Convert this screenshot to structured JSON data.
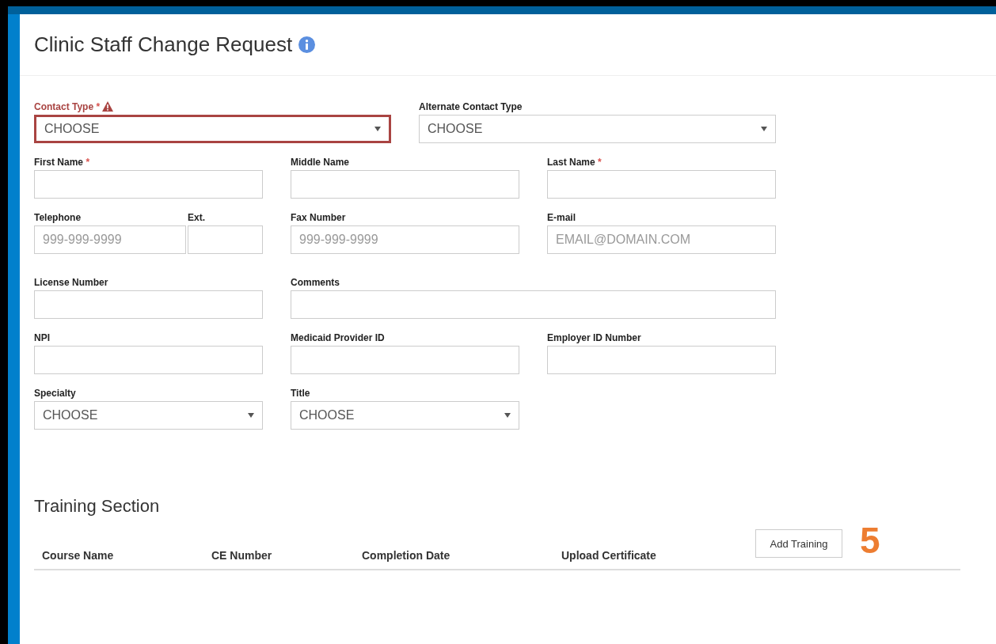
{
  "title": "Clinic Staff Change Request",
  "rows": [
    {
      "kind": "pair",
      "fields": [
        {
          "kind": "select",
          "label": "Contact Type",
          "required_mark": "*",
          "error": true,
          "value": "CHOOSE"
        },
        {
          "kind": "select",
          "label": "Alternate Contact Type",
          "error": false,
          "value": "CHOOSE"
        }
      ]
    },
    {
      "kind": "triple",
      "fields": [
        {
          "kind": "text",
          "label": "First Name",
          "required_mark": "*"
        },
        {
          "kind": "text",
          "label": "Middle Name"
        },
        {
          "kind": "text",
          "label": "Last Name",
          "required_mark": "*"
        }
      ]
    },
    {
      "kind": "triple",
      "fields": [
        {
          "kind": "phone",
          "label": "Telephone",
          "placeholder": "999-999-9999",
          "ext_label": "Ext."
        },
        {
          "kind": "text",
          "label": "Fax Number",
          "placeholder": "999-999-9999"
        },
        {
          "kind": "text",
          "label": "E-mail",
          "placeholder": "EMAIL@DOMAIN.COM"
        }
      ]
    },
    {
      "kind": "triple",
      "fields": [
        {
          "kind": "text",
          "label": "License Number"
        },
        {
          "kind": "wide",
          "label": "Comments"
        }
      ]
    },
    {
      "kind": "triple",
      "fields": [
        {
          "kind": "text",
          "label": "NPI"
        },
        {
          "kind": "text",
          "label": "Medicaid Provider ID"
        },
        {
          "kind": "text",
          "label": "Employer ID Number"
        }
      ]
    },
    {
      "kind": "triple",
      "fields": [
        {
          "kind": "select",
          "label": "Specialty",
          "error": false,
          "value": "CHOOSE"
        },
        {
          "kind": "select",
          "label": "Title",
          "error": false,
          "value": "CHOOSE"
        }
      ]
    }
  ],
  "training": {
    "title": "Training Section",
    "columns": [
      "Course Name",
      "CE Number",
      "Completion Date",
      "Upload Certificate"
    ],
    "button": "Add Training"
  },
  "annotation": "5"
}
